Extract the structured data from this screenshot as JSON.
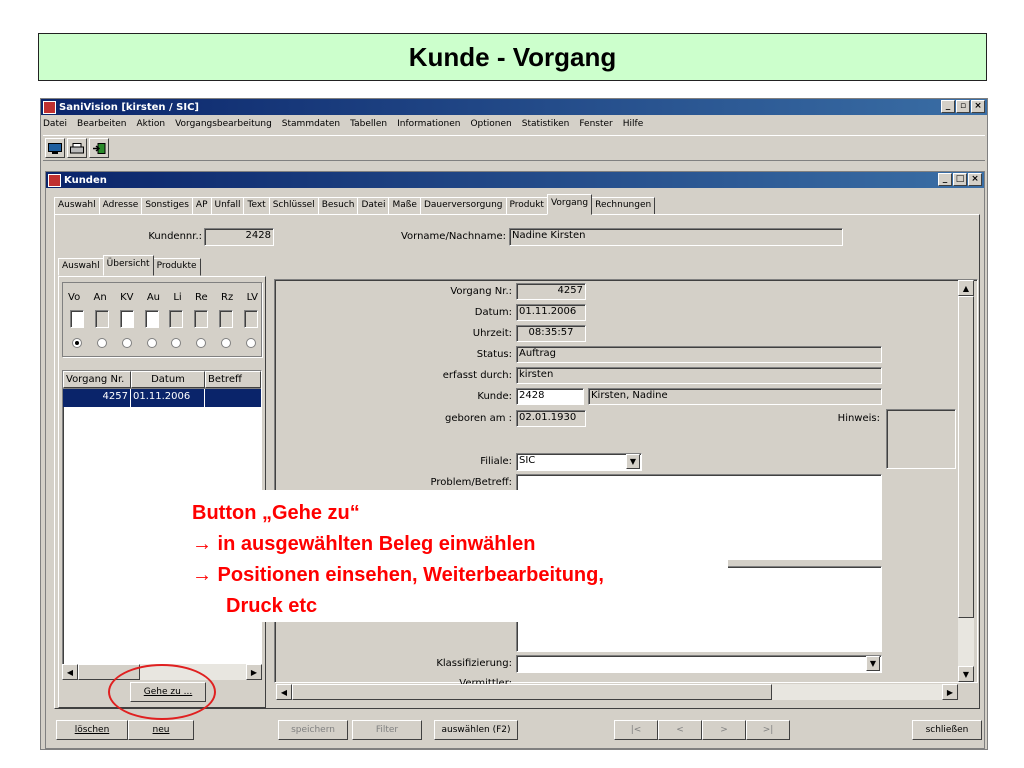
{
  "slide": {
    "title": "Kunde - Vorgang"
  },
  "app": {
    "title": "SaniVision  [kirsten / SIC]",
    "menu": [
      "Datei",
      "Bearbeiten",
      "Aktion",
      "Vorgangsbearbeitung",
      "Stammdaten",
      "Tabellen",
      "Informationen",
      "Optionen",
      "Statistiken",
      "Fenster",
      "Hilfe"
    ],
    "toolbar_icons": [
      "monitor-icon",
      "printer-icon",
      "exit-door-icon"
    ]
  },
  "window": {
    "title": "Kunden",
    "tabs": [
      "Auswahl",
      "Adresse",
      "Sonstiges",
      "AP",
      "Unfall",
      "Text",
      "Schlüssel",
      "Besuch",
      "Datei",
      "Maße",
      "Dauerversorgung",
      "Produkt",
      "Vorgang",
      "Rechnungen"
    ],
    "active_tab": "Vorgang",
    "kundennr_label": "Kundennr.:",
    "kundennr_value": "2428",
    "name_label": "Vorname/Nachname:",
    "name_value": "Nadine Kirsten",
    "subtabs": [
      "Auswahl",
      "Übersicht",
      "Produkte"
    ],
    "active_subtab": "Übersicht"
  },
  "filters": {
    "labels": [
      "Vo",
      "An",
      "KV",
      "Au",
      "Li",
      "Re",
      "Rz",
      "LV"
    ],
    "checkbox_enabled": [
      true,
      false,
      true,
      true,
      false,
      false,
      false,
      false
    ],
    "selected_radio": 0
  },
  "grid": {
    "columns": [
      "Vorgang Nr.",
      "Datum",
      "Betreff"
    ],
    "rows": [
      {
        "nr": "4257",
        "datum": "01.11.2006",
        "betreff": ""
      }
    ]
  },
  "goto_button": "Gehe zu ...",
  "detail": {
    "vorgang_nr_label": "Vorgang Nr.:",
    "vorgang_nr": "4257",
    "datum_label": "Datum:",
    "datum": "01.11.2006",
    "uhrzeit_label": "Uhrzeit:",
    "uhrzeit": "08:35:57",
    "status_label": "Status:",
    "status": "Auftrag",
    "erfasst_label": "erfasst durch:",
    "erfasst": "kirsten",
    "kunde_label": "Kunde:",
    "kunde_nr": "2428",
    "kunde_name": "Kirsten, Nadine",
    "geboren_label": "geboren am :",
    "geboren": "02.01.1930",
    "hinweis_label": "Hinweis:",
    "filiale_label": "Filiale:",
    "filiale": "SIC",
    "problem_label": "Problem/Betreff:",
    "klassifizierung_label": "Klassifizierung:",
    "vermittler_label": "Vermittler:"
  },
  "bottom_buttons": {
    "loeschen": "löschen",
    "neu": "neu",
    "speichern": "speichern",
    "filter": "Filter",
    "auswaehlen": "auswählen (F2)",
    "first": "|<",
    "prev": "<",
    "next": ">",
    "last": ">|",
    "schliessen": "schließen"
  },
  "annotation": {
    "line1": "Button „Gehe zu“",
    "line2": "→ in ausgewählten Beleg einwählen",
    "line3": "→ Positionen einsehen, Weiterbearbeitung,",
    "line4": "Druck etc"
  },
  "colors": {
    "selection": "#0a246a",
    "annotation_red": "#ff0000",
    "slide_title_bg": "#ccffcc"
  }
}
